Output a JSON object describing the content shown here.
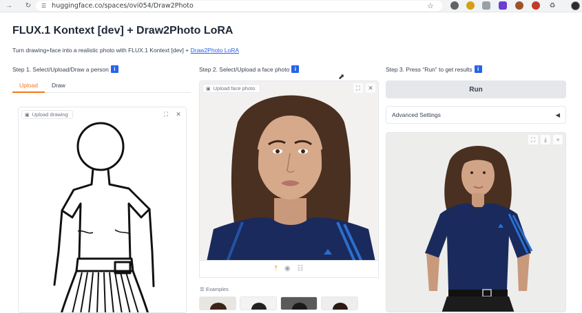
{
  "browser": {
    "url": "huggingface.co/spaces/ovi054/Draw2Photo",
    "back_icon": "back-arrow",
    "reload_icon": "reload"
  },
  "page": {
    "title": "FLUX.1 Kontext [dev] + Draw2Photo LoRA",
    "description_prefix": "Turn drawing+face into a realistic photo with FLUX.1 Kontext [dev] + ",
    "description_link": "Draw2Photo LoRA"
  },
  "step1": {
    "label": "Step 1. Select/Upload/Draw a person",
    "info": "i",
    "tabs": [
      "Upload",
      "Draw"
    ],
    "active_tab": "Upload",
    "panel_label": "Upload drawing"
  },
  "step2": {
    "label": "Step 2. Select/Upload a face photo",
    "info": "i",
    "panel_label": "Upload face photo",
    "examples_label": "Examples"
  },
  "step3": {
    "label": "Step 3. Press “Run” to get results",
    "info": "i",
    "run_label": "Run",
    "advanced_label": "Advanced Settings",
    "advanced_arrow": "◀"
  },
  "colors": {
    "accent": "#f97316",
    "info": "#2563eb",
    "shirt": "#1a2a5c",
    "hair": "#4a3020"
  }
}
